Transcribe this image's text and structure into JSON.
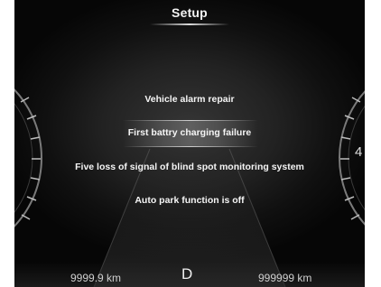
{
  "screen": {
    "title": "Setup"
  },
  "messages": [
    {
      "text": "Vehicle alarm repair",
      "selected": false
    },
    {
      "text": "First battry charging failure",
      "selected": true
    },
    {
      "text": "Five loss of signal of blind spot monitoring system",
      "selected": false
    },
    {
      "text": "Auto park function is off",
      "selected": false
    }
  ],
  "gauges": {
    "right_digit": "4"
  },
  "status_bar": {
    "trip_distance": "9999.9 km",
    "gear": "D",
    "odometer": "999999 km"
  },
  "colors": {
    "background": "#1c1c1c",
    "text": "#f5f5f5",
    "highlight": "#6e6e6e"
  }
}
